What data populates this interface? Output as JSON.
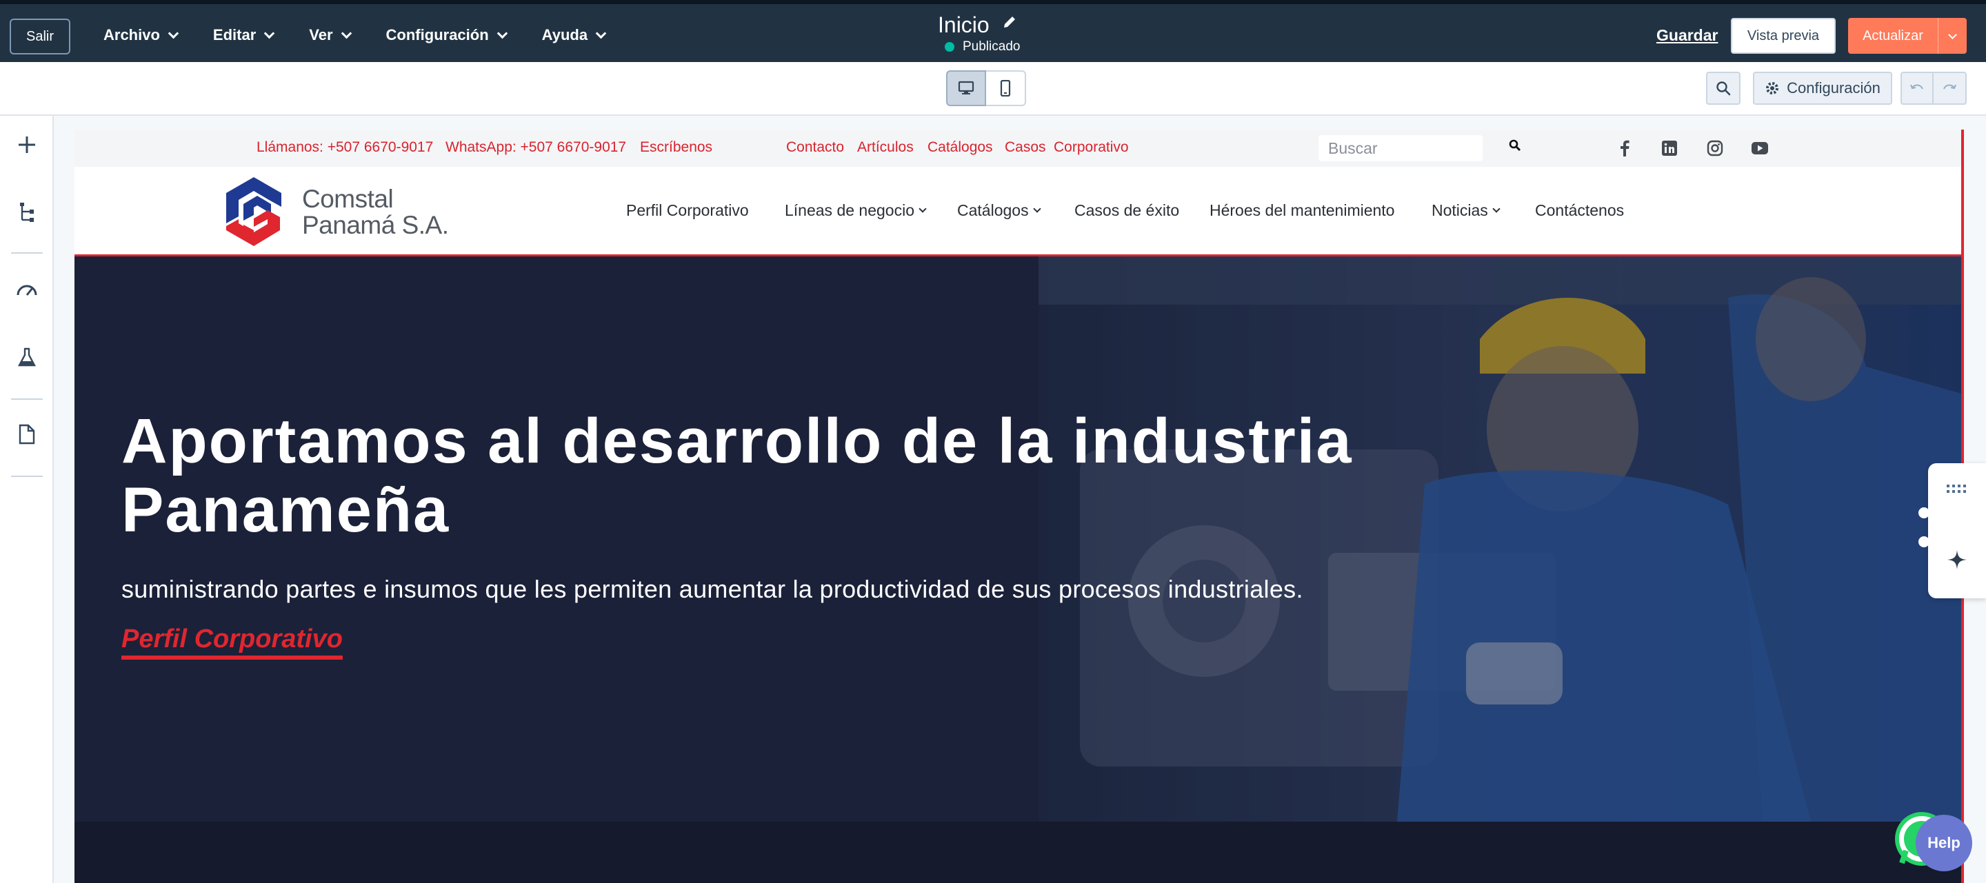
{
  "editor": {
    "exit_label": "Salir",
    "menus": [
      "Archivo",
      "Editar",
      "Ver",
      "Configuración",
      "Ayuda"
    ],
    "page_title": "Inicio",
    "status": "Publicado",
    "save_label": "Guardar",
    "preview_label": "Vista previa",
    "update_label": "Actualizar",
    "settings_label": "Configuración"
  },
  "site": {
    "topbar": {
      "phone": "Llámanos: +507 6670-9017",
      "whatsapp": "WhatsApp: +507 6670-9017",
      "write": "Escríbenos",
      "links": [
        "Contacto",
        "Artículos",
        "Catálogos",
        "Casos",
        "Corporativo"
      ],
      "search_placeholder": "Buscar"
    },
    "logo": {
      "line1": "Comstal",
      "line2": "Panamá S.A."
    },
    "nav": [
      "Perfil Corporativo",
      "Líneas de negocio",
      "Catálogos",
      "Casos de éxito",
      "Héroes del mantenimiento",
      "Noticias",
      "Contáctenos"
    ],
    "hero": {
      "title_line1": "Aportamos al desarrollo de la industria",
      "title_line2": "Panameña",
      "subtitle": "suministrando partes e insumos que les permiten aumentar la productividad de sus procesos industriales.",
      "cta": "Perfil Corporativo"
    }
  },
  "help_label": "Help",
  "colors": {
    "editor_bar": "#213343",
    "accent_orange": "#ff7a59",
    "brand_red": "#e0262f",
    "brand_blue": "#1f3a93",
    "hero_bg": "#1b2138"
  }
}
